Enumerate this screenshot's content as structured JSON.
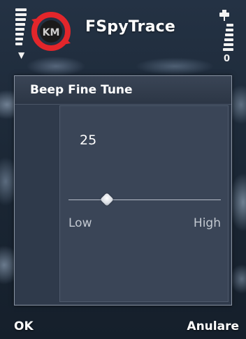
{
  "status_bar": {
    "signal_icon": "signal-strength-icon",
    "battery_icon": "battery-charging-icon",
    "battery_indicator_text": "0"
  },
  "app": {
    "title": "FSpyTrace",
    "icon": "fspytrace-logo-icon",
    "icon_colors": {
      "ring": "#e3262b",
      "center": "#1a1a1a"
    },
    "icon_text": "KM"
  },
  "dialog": {
    "title": "Beep Fine Tune",
    "value": "25",
    "slider": {
      "min_label": "Low",
      "max_label": "High",
      "level": 0.25
    }
  },
  "softkeys": {
    "left": "OK",
    "right": "Anulare"
  },
  "colors": {
    "dialog_bg": "#2f3a4b",
    "body_bg": "#3a4557",
    "text": "#ffffff"
  }
}
